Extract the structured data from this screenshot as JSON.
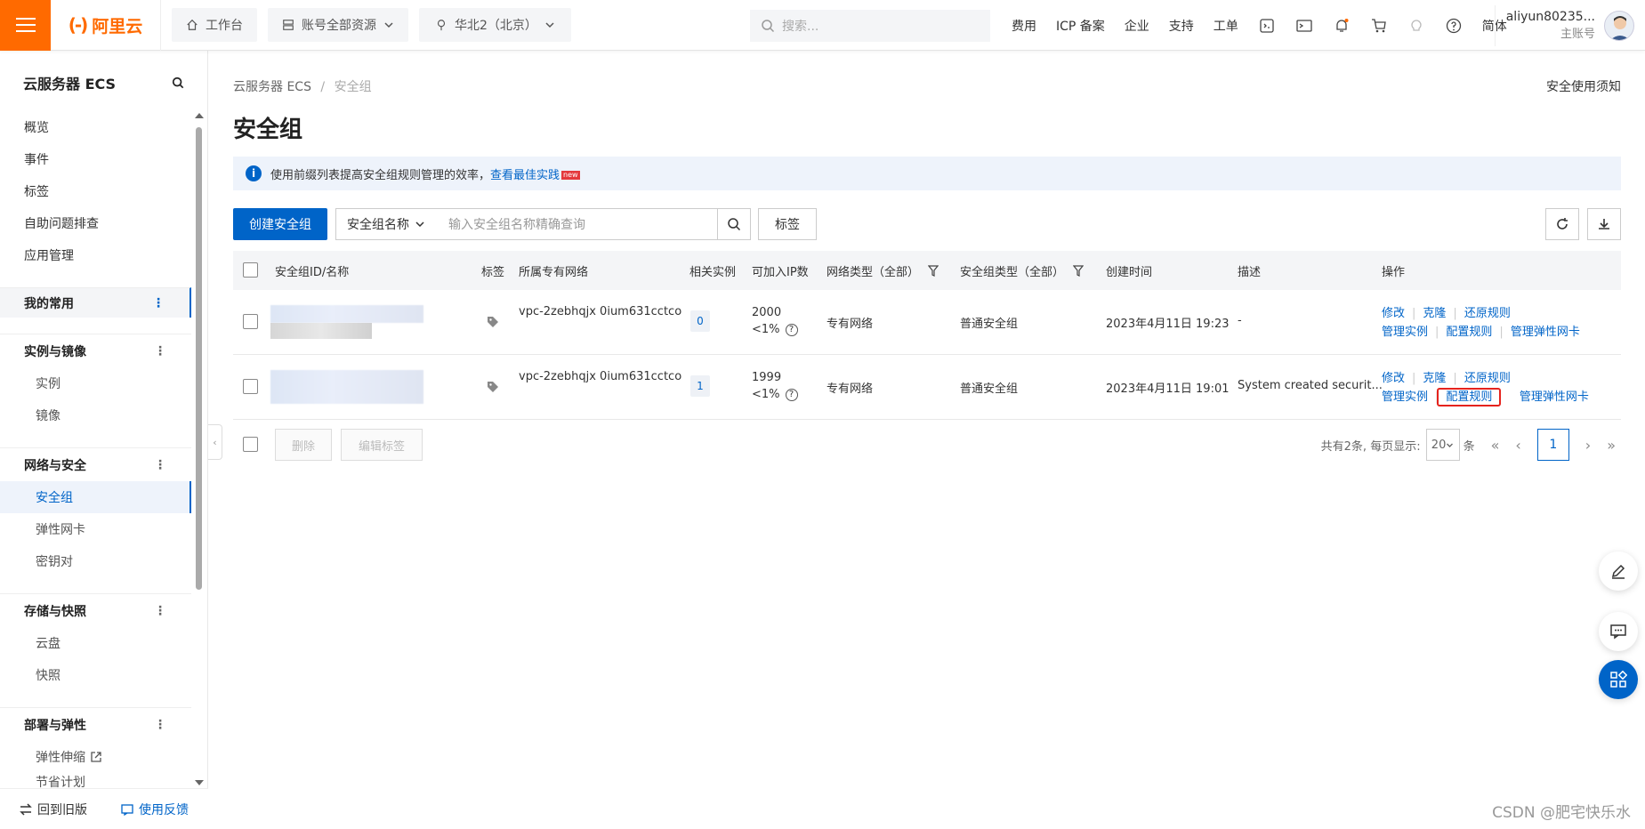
{
  "topbar": {
    "brand": "阿里云",
    "workbench": "工作台",
    "resources": "账号全部资源",
    "region": "华北2（北京）",
    "search_placeholder": "搜索...",
    "links": [
      "费用",
      "ICP 备案",
      "企业",
      "支持",
      "工单"
    ],
    "lang": "简体",
    "user_name": "aliyun80235...",
    "user_role": "主账号"
  },
  "sidebar": {
    "title": "云服务器 ECS",
    "top_items": [
      "概览",
      "事件",
      "标签",
      "自助问题排查",
      "应用管理"
    ],
    "favorites": "我的常用",
    "groups": [
      {
        "label": "实例与镜像",
        "items": [
          "实例",
          "镜像"
        ]
      },
      {
        "label": "网络与安全",
        "items": [
          "安全组",
          "弹性网卡",
          "密钥对"
        ]
      },
      {
        "label": "存储与快照",
        "items": [
          "云盘",
          "快照"
        ]
      },
      {
        "label": "部署与弹性",
        "items": [
          "弹性伸缩",
          "节省计划"
        ]
      }
    ],
    "back_old": "回到旧版",
    "feedback": "使用反馈"
  },
  "main": {
    "breadcrumb_root": "云服务器 ECS",
    "breadcrumb_sep": "/",
    "breadcrumb_current": "安全组",
    "notice_link": "安全使用须知",
    "title": "安全组",
    "banner_text": "使用前缀列表提高安全组规则管理的效率，",
    "banner_link": "查看最佳实践",
    "banner_new": "new",
    "create_button": "创建安全组",
    "filter_select": "安全组名称",
    "search_placeholder": "输入安全组名称精确查询",
    "tag_button": "标签"
  },
  "table": {
    "headers": [
      "安全组ID/名称",
      "标签",
      "所属专有网络",
      "相关实例",
      "可加入IP数",
      "网络类型（全部）",
      "安全组类型（全部）",
      "创建时间",
      "描述",
      "操作"
    ],
    "rows": [
      {
        "vpc": "vpc-2zebhqjx  0ium631cctco",
        "instances": "0",
        "ip_count": "2000",
        "ip_usage": "<1%",
        "network_type": "专有网络",
        "sg_type": "普通安全组",
        "created": "2023年4月11日 19:23",
        "desc": "-",
        "ops1": [
          "修改",
          "克隆",
          "还原规则"
        ],
        "ops2": [
          "管理实例",
          "配置规则",
          "管理弹性网卡"
        ]
      },
      {
        "vpc": "vpc-2zebhqjx  0ium631cctco",
        "instances": "1",
        "ip_count": "1999",
        "ip_usage": "<1%",
        "network_type": "专有网络",
        "sg_type": "普通安全组",
        "created": "2023年4月11日 19:01",
        "desc": "System created securit...",
        "ops1": [
          "修改",
          "克隆",
          "还原规则"
        ],
        "ops2": [
          "管理实例",
          "配置规则",
          "管理弹性网卡"
        ]
      }
    ]
  },
  "footer": {
    "delete": "删除",
    "edit_tags": "编辑标签",
    "total_text": "共有2条, 每页显示:",
    "page_size": "20",
    "unit": "条",
    "current_page": "1"
  },
  "watermark": "CSDN @肥宅快乐水",
  "colors": {
    "brand": "#ff6a00",
    "primary": "#0064c8",
    "highlight": "#e5231d"
  }
}
